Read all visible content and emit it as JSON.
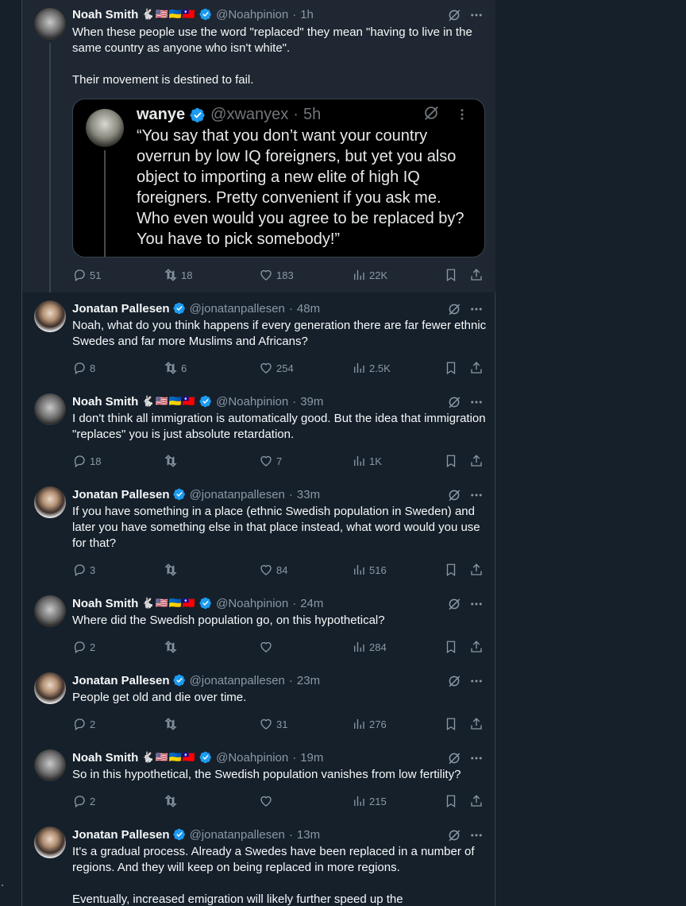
{
  "tweets": [
    {
      "name": "Noah Smith",
      "flags": "🐇🇺🇸🇺🇦🇹🇼",
      "handle": "@Noahpinion",
      "time": "1h",
      "body": "When these people use the word \"replaced\" they mean \"having to live in the same country as anyone who isn't white\".\n\nTheir movement is destined to fail.",
      "replies": "51",
      "reposts": "18",
      "likes": "183",
      "views": "22K",
      "quote": {
        "name": "wanye",
        "handle": "@xwanyex",
        "time": "5h",
        "text": "“You say that you don’t want your country overrun by low IQ foreigners, but yet you also object to importing a new elite of high IQ foreigners. Pretty convenient if you ask me. Who even would you agree to be replaced by? You have to pick somebody!”"
      }
    },
    {
      "name": "Jonatan Pallesen",
      "handle": "@jonatanpallesen",
      "time": "48m",
      "body": "Noah, what do you think happens if every generation there are far fewer ethnic Swedes and far more Muslims and Africans?",
      "replies": "8",
      "reposts": "6",
      "likes": "254",
      "views": "2.5K"
    },
    {
      "name": "Noah Smith",
      "flags": "🐇🇺🇸🇺🇦🇹🇼",
      "handle": "@Noahpinion",
      "time": "39m",
      "body": "I don't think all immigration is automatically good. But the idea that immigration \"replaces\" you is just absolute retardation.",
      "replies": "18",
      "reposts": "",
      "likes": "7",
      "views": "1K"
    },
    {
      "name": "Jonatan Pallesen",
      "handle": "@jonatanpallesen",
      "time": "33m",
      "body": "If you have something in a place (ethnic Swedish population in Sweden) and later you have something else in that place instead, what word would you use for that?",
      "replies": "3",
      "reposts": "",
      "likes": "84",
      "views": "516"
    },
    {
      "name": "Noah Smith",
      "flags": "🐇🇺🇸🇺🇦🇹🇼",
      "handle": "@Noahpinion",
      "time": "24m",
      "body": "Where did the Swedish population go, on this hypothetical?",
      "replies": "2",
      "reposts": "",
      "likes": "",
      "views": "284"
    },
    {
      "name": "Jonatan Pallesen",
      "handle": "@jonatanpallesen",
      "time": "23m",
      "body": "People get old and die over time.",
      "replies": "2",
      "reposts": "",
      "likes": "31",
      "views": "276"
    },
    {
      "name": "Noah Smith",
      "flags": "🐇🇺🇸🇺🇦🇹🇼",
      "handle": "@Noahpinion",
      "time": "19m",
      "body": "So in this hypothetical, the Swedish population vanishes from low fertility?",
      "replies": "2",
      "reposts": "",
      "likes": "",
      "views": "215"
    },
    {
      "name": "Jonatan Pallesen",
      "handle": "@jonatanpallesen",
      "time": "13m",
      "body": "It's a gradual process. Already a Swedes have been replaced in a number of regions. And they will keep on being replaced in more regions.\n\nEventually, increased emigration will likely further speed up the",
      "replies": "",
      "reposts": "",
      "likes": "",
      "views": ""
    }
  ],
  "separator": "·",
  "colors": {
    "background": "#15202b",
    "highlight": "#1e2732",
    "verified": "#1d9bf0",
    "muted": "#8b98a5"
  }
}
